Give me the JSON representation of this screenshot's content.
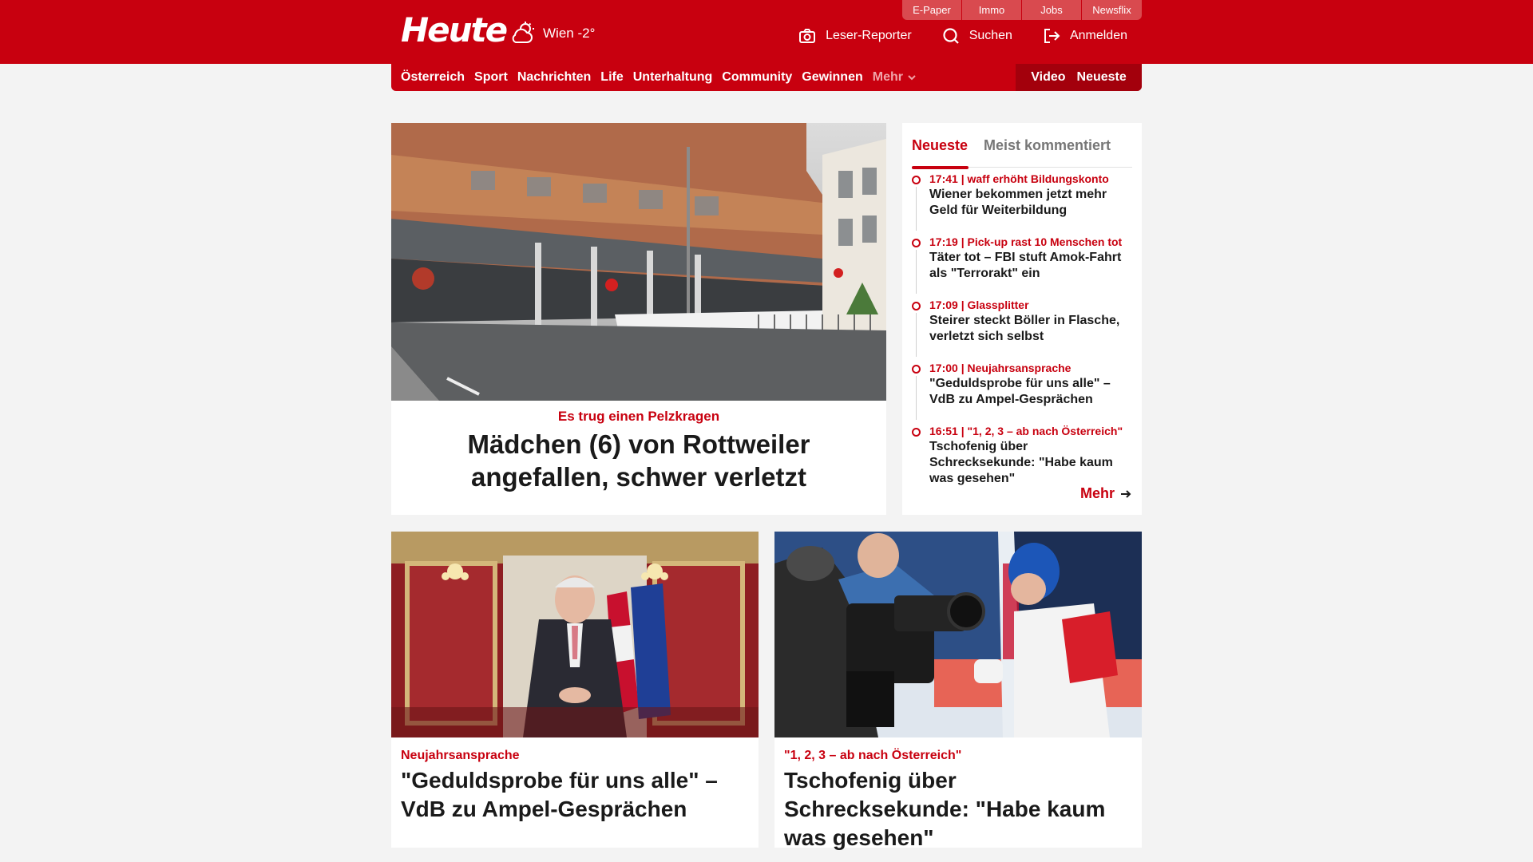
{
  "header": {
    "logo": "Heute",
    "weather": "Wien -2°",
    "services": [
      "E-Paper",
      "Immo",
      "Jobs",
      "Newsflix"
    ],
    "actions": {
      "reporter": "Leser-Reporter",
      "search": "Suchen",
      "login": "Anmelden"
    }
  },
  "nav": {
    "items": [
      "Österreich",
      "Sport",
      "Nachrichten",
      "Life",
      "Unterhaltung",
      "Community",
      "Gewinnen"
    ],
    "more": "Mehr",
    "video": "Video",
    "latest": "Neueste"
  },
  "hero": {
    "kicker": "Es trug einen Pelzkragen",
    "title": "Mädchen (6) von Rottweiler angefallen, schwer verletzt"
  },
  "sidebar": {
    "tabs": [
      "Neueste",
      "Meist kommentiert"
    ],
    "items": [
      {
        "meta": "17:41 | waff erhöht Bildungskonto",
        "title": "Wiener bekommen jetzt mehr Geld für Weiterbildung"
      },
      {
        "meta": "17:19 | Pick-up rast 10 Menschen tot",
        "title": "Täter tot – FBI stuft Amok-Fahrt als \"Terrorakt\" ein"
      },
      {
        "meta": "17:09 | Glassplitter",
        "title": "Steirer steckt Böller in Flasche, verletzt sich selbst"
      },
      {
        "meta": "17:00 | Neujahrsansprache",
        "title": "\"Geduldsprobe für uns alle\" – VdB zu Ampel-Gesprächen"
      },
      {
        "meta": "16:51 | \"1, 2, 3 – ab nach Österreich\"",
        "title": "Tschofenig über Schrecksekunde: \"Habe kaum was gesehen\""
      }
    ],
    "more": "Mehr"
  },
  "cards": [
    {
      "kicker": "Neujahrsansprache",
      "title": "\"Geduldsprobe für uns alle\" – VdB zu Ampel-Gesprächen"
    },
    {
      "kicker": "\"1, 2, 3 – ab nach Österreich\"",
      "title": "Tschofenig über Schrecksekunde: \"Habe kaum was gesehen\""
    }
  ],
  "colors": {
    "brand_red": "#c8000f",
    "dark_red": "#a3000c",
    "background": "#f3f3f3"
  }
}
